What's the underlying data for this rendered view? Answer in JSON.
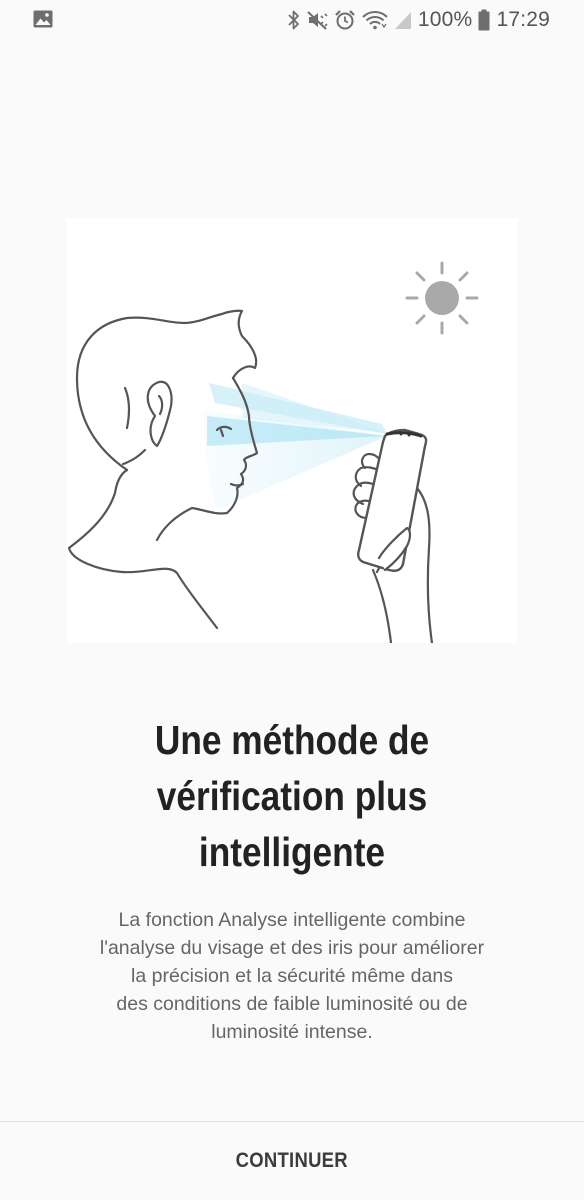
{
  "status_bar": {
    "gallery_icon": "image-icon",
    "icons": [
      "bluetooth-icon",
      "mute-icon",
      "alarm-icon",
      "wifi-icon",
      "signal-icon"
    ],
    "battery_percent": "100%",
    "battery_icon": "battery-icon",
    "time": "17:29"
  },
  "illustration": {
    "subject": "face-scan-illustration",
    "sun_icon": "sun-icon",
    "scan_beam_color": "#bfe9f6"
  },
  "onboarding": {
    "title_lines": [
      "Une méthode de",
      "vérification plus",
      "intelligente"
    ],
    "description_lines": [
      "La fonction Analyse intelligente combine",
      "l'analyse du visage et des iris pour améliorer",
      "la précision et la sécurité même dans",
      "des conditions de faible luminosité ou de",
      "luminosité intense."
    ]
  },
  "footer": {
    "continue_label": "CONTINUER"
  }
}
